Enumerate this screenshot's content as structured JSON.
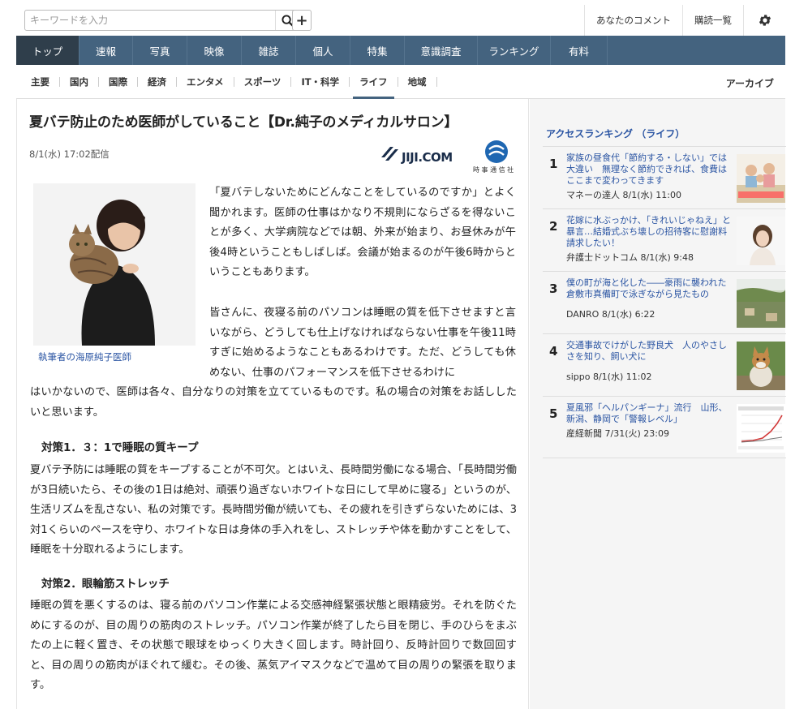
{
  "search": {
    "placeholder": "キーワードを入力"
  },
  "top_links": {
    "comments": "あなたのコメント",
    "subscriptions": "購読一覧"
  },
  "main_nav": [
    {
      "label": "トップ",
      "active": true
    },
    {
      "label": "速報"
    },
    {
      "label": "写真"
    },
    {
      "label": "映像"
    },
    {
      "label": "雑誌"
    },
    {
      "label": "個人"
    },
    {
      "label": "特集"
    },
    {
      "label": "意識調査"
    },
    {
      "label": "ランキング"
    },
    {
      "label": "有料"
    }
  ],
  "sub_nav": [
    {
      "label": "主要"
    },
    {
      "label": "国内"
    },
    {
      "label": "国際"
    },
    {
      "label": "経済"
    },
    {
      "label": "エンタメ"
    },
    {
      "label": "スポーツ"
    },
    {
      "label": "IT・科学"
    },
    {
      "label": "ライフ",
      "active": true
    },
    {
      "label": "地域"
    }
  ],
  "archive_label": "アーカイブ",
  "article": {
    "title": "夏バテ防止のため医師がしていること【Dr.純子のメディカルサロン】",
    "date": "8/1(水) 17:02配信",
    "provider_logo": "JIJI.COM",
    "provider_sub": "時 事 通 信 社",
    "photo_caption": "執筆者の海原純子医師",
    "p1": "「夏バテしないためにどんなことをしているのですか」とよく聞かれます。医師の仕事はかなり不規則にならざるを得ないことが多く、大学病院などでは朝、外来が始まり、お昼休みが午後4時ということもしばしば。会議が始まるのが午後6時からということもあります。",
    "p2": "皆さんに、夜寝る前のパソコンは睡眠の質を低下させますと言いながら、どうしても仕上げなければならない仕事を午後11時すぎに始めるようなこともあるわけです。ただ、どうしても休めない、仕事のパフォーマンスを低下させるわけに",
    "p2b": "はいかないので、医師は各々、自分なりの対策を立てているものです。私の場合の対策をお話ししたいと思います。",
    "h1": "対策1．３：1で睡眠の質キープ",
    "p3": "夏バテ予防には睡眠の質をキープすることが不可欠。とはいえ、長時間労働になる場合、「長時間労働が3日続いたら、その後の1日は絶対、頑張り過ぎないホワイトな日にして早めに寝る」というのが、生活リズムを乱さない、私の対策です。長時間労働が続いても、その疲れを引きずらないためには、3対1くらいのペースを守り、ホワイトな日は身体の手入れをし、ストレッチや体を動かすことをして、睡眠を十分取れるようにします。",
    "h2": "対策2．眼輪筋ストレッチ",
    "p4": "睡眠の質を悪くするのは、寝る前のパソコン作業による交感神経緊張状態と眼精疲労。それを防ぐためにするのが、目の周りの筋肉のストレッチ。パソコン作業が終了したら目を閉じ、手のひらをまぶたの上に軽く置き、その状態で眼球をゆっくり大きく回します。時計回り、反時計回りで数回回すと、目の周りの筋肉がほぐれて緩む。その後、蒸気アイマスクなどで温めて目の周りの緊張を取ります。"
  },
  "ranking": {
    "heading": "アクセスランキング （ライフ）",
    "items": [
      {
        "rank": "1",
        "title": "家族の昼食代「節約する・しない」では大違い　無理なく節約できれば、食費はここまで変わってきます",
        "meta": "マネーの達人 8/1(水) 11:00",
        "thumb": "family-photo"
      },
      {
        "rank": "2",
        "title": "花嫁に水ぶっかけ、「きれいじゃねえ」と暴言…結婚式ぶち壊しの招待客に慰謝料請求したい！",
        "meta": "弁護士ドットコム 8/1(水) 9:48",
        "thumb": "woman-photo"
      },
      {
        "rank": "3",
        "title": "僕の町が海と化した――豪雨に襲われた倉敷市真備町で泳ぎながら見たもの",
        "meta": "DANRO 8/1(水) 6:22",
        "thumb": "flood-photo"
      },
      {
        "rank": "4",
        "title": "交通事故でけがした野良犬　人のやさしさを知り、飼い犬に",
        "meta": "sippo 8/1(水) 11:02",
        "thumb": "dog-photo"
      },
      {
        "rank": "5",
        "title": "夏風邪「ヘルパンギーナ」流行　山形、新潟、静岡で「警報レベル」",
        "meta": "産経新聞 7/31(火) 23:09",
        "thumb": "chart-photo"
      }
    ]
  },
  "colors": {
    "nav_bg": "#44637f",
    "nav_active": "#2f3e4b",
    "link": "#2b55a3"
  }
}
